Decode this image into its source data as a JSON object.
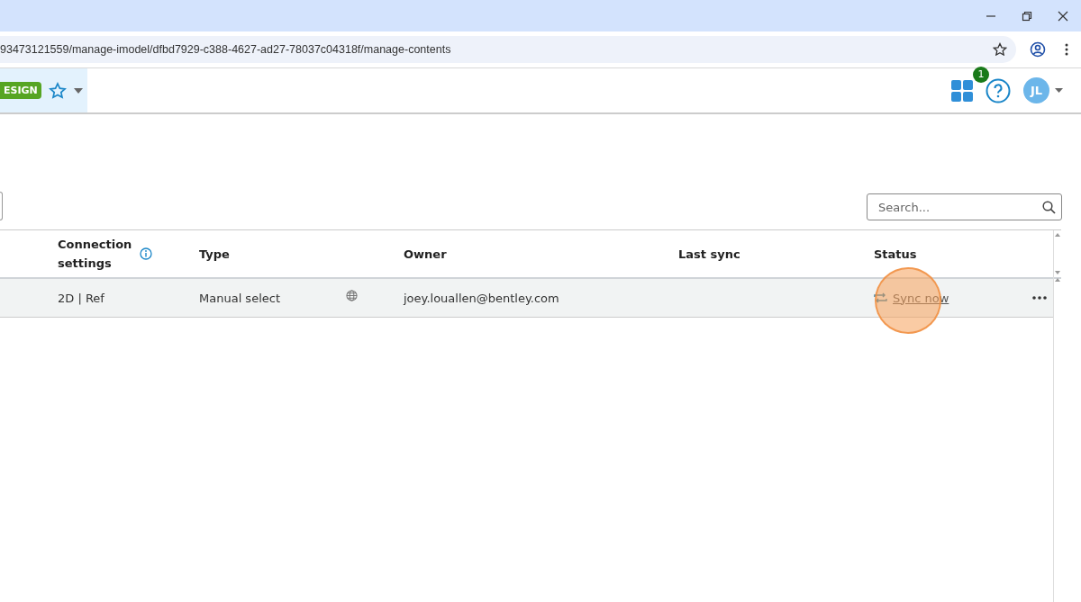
{
  "browser": {
    "url": "93473121559/manage-imodel/dfbd7929-c388-4627-ad27-78037c04318f/manage-contents"
  },
  "app_header": {
    "badge": "ESIGN",
    "notification_count": "1",
    "avatar_initials": "JL"
  },
  "search": {
    "placeholder": "Search..."
  },
  "table": {
    "columns": [
      {
        "label": "Connection settings",
        "info": true
      },
      {
        "label": "Type",
        "info": false
      },
      {
        "label": "Owner",
        "info": false
      },
      {
        "label": "Last sync",
        "info": false
      },
      {
        "label": "Status",
        "info": false
      }
    ],
    "rows": [
      {
        "connection_settings": "2D | Ref",
        "type": "Manual select",
        "owner": "joey.louallen@bentley.com",
        "last_sync": "",
        "status": "Sync now",
        "hovered": true
      }
    ]
  }
}
